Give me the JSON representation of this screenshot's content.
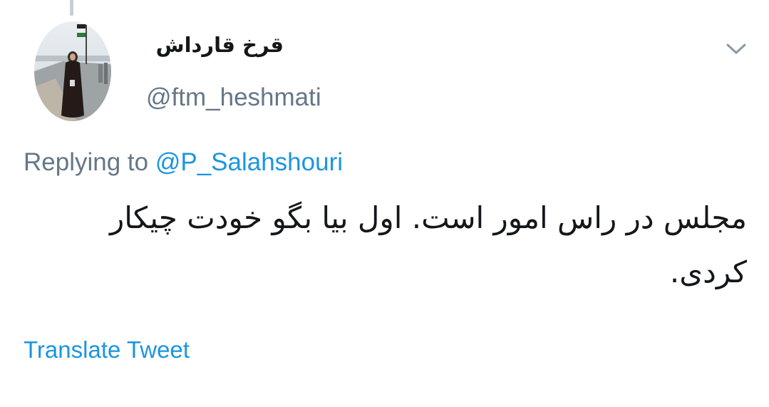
{
  "tweet": {
    "author": {
      "display_name": "قرخ قارداش",
      "handle": "@ftm_heshmati",
      "avatar": "profile-photo"
    },
    "reply": {
      "prefix": "Replying to ",
      "mention": "@P_Salahshouri"
    },
    "text": "مجلس در راس امور است. اول بیا بگو خودت چیکار کردی.",
    "translate_label": "Translate Tweet",
    "menu_icon": "chevron-down-icon"
  },
  "colors": {
    "link": "#1b95e0",
    "secondary_text": "#657786",
    "primary_text": "#14171a",
    "thread_line": "#c4cfd6"
  }
}
